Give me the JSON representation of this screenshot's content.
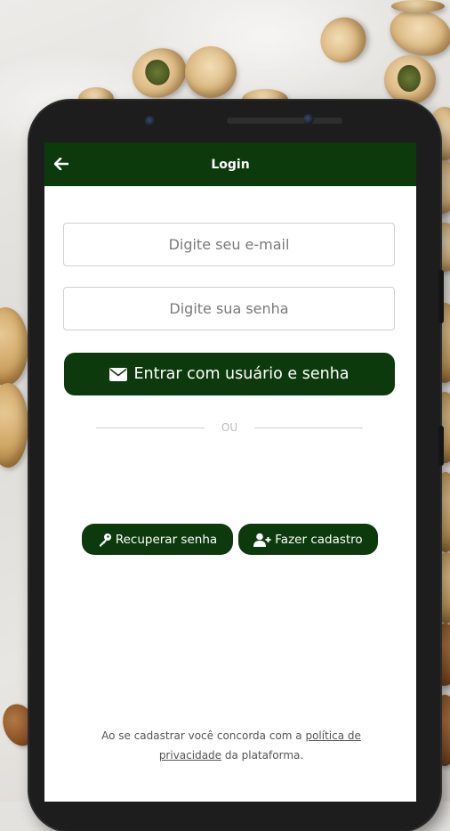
{
  "appbar": {
    "title": "Login",
    "back_icon": "arrow-left-icon"
  },
  "login_form": {
    "email_placeholder": "Digite seu e-mail",
    "password_placeholder": "Digite sua senha",
    "submit_label": "Entrar com usuário e senha",
    "submit_icon": "envelope-icon"
  },
  "divider": {
    "text": "OU"
  },
  "actions": {
    "recover_label": "Recuperar senha",
    "recover_icon": "key-icon",
    "signup_label": "Fazer cadastro",
    "signup_icon": "user-plus-icon"
  },
  "legal": {
    "prefix": "Ao se cadastrar você concorda com a ",
    "link": "política de privacidade",
    "suffix": " da plataforma."
  },
  "colors": {
    "primary": "#0d3a0c",
    "background": "#ffffff",
    "text_muted": "#555555"
  }
}
